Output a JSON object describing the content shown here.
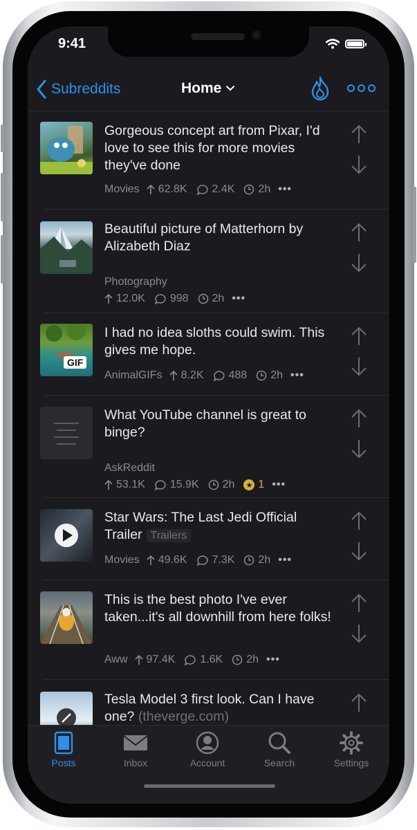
{
  "status": {
    "time": "9:41"
  },
  "nav": {
    "back_label": "Subreddits",
    "title": "Home"
  },
  "posts": [
    {
      "title": "Gorgeous concept art from Pixar, I'd love to see this for more movies they've done",
      "subreddit": "Movies",
      "upvotes": "62.8K",
      "comments": "2.4K",
      "age": "2h",
      "thumb": "pixar-art"
    },
    {
      "title": "Beautiful picture of Matterhorn by Alizabeth Diaz",
      "subreddit": "Photography",
      "upvotes": "12.0K",
      "comments": "998",
      "age": "2h",
      "thumb": "matterhorn"
    },
    {
      "title": "I had no idea sloths could swim. This gives me hope.",
      "subreddit": "AnimalGIFs",
      "upvotes": "8.2K",
      "comments": "488",
      "age": "2h",
      "thumb": "sloth-gif",
      "badge": "GIF"
    },
    {
      "title": "What YouTube channel is great to binge?",
      "subreddit": "AskReddit",
      "upvotes": "53.1K",
      "comments": "15.9K",
      "age": "2h",
      "awards": "1",
      "thumb": "text-post"
    },
    {
      "title": "Star Wars: The Last Jedi Official Trailer",
      "tag": "Trailers",
      "subreddit": "Movies",
      "upvotes": "49.6K",
      "comments": "7.3K",
      "age": "2h",
      "thumb": "video"
    },
    {
      "title": "This is the best photo I've ever taken...it's all downhill from here folks!",
      "subreddit": "Aww",
      "upvotes": "97.4K",
      "comments": "1.6K",
      "age": "2h",
      "thumb": "dog-bridge"
    },
    {
      "title": "Tesla Model 3 first look. Can I have one?",
      "domain": "(theverge.com)",
      "thumb": "link"
    }
  ],
  "tabs": [
    {
      "label": "Posts",
      "icon": "posts-icon",
      "active": true
    },
    {
      "label": "Inbox",
      "icon": "inbox-icon"
    },
    {
      "label": "Account",
      "icon": "account-icon"
    },
    {
      "label": "Search",
      "icon": "search-icon"
    },
    {
      "label": "Settings",
      "icon": "settings-icon"
    }
  ],
  "colors": {
    "accent": "#2f8fe8",
    "background": "#1b1b1f",
    "gold": "#d4b13c"
  }
}
